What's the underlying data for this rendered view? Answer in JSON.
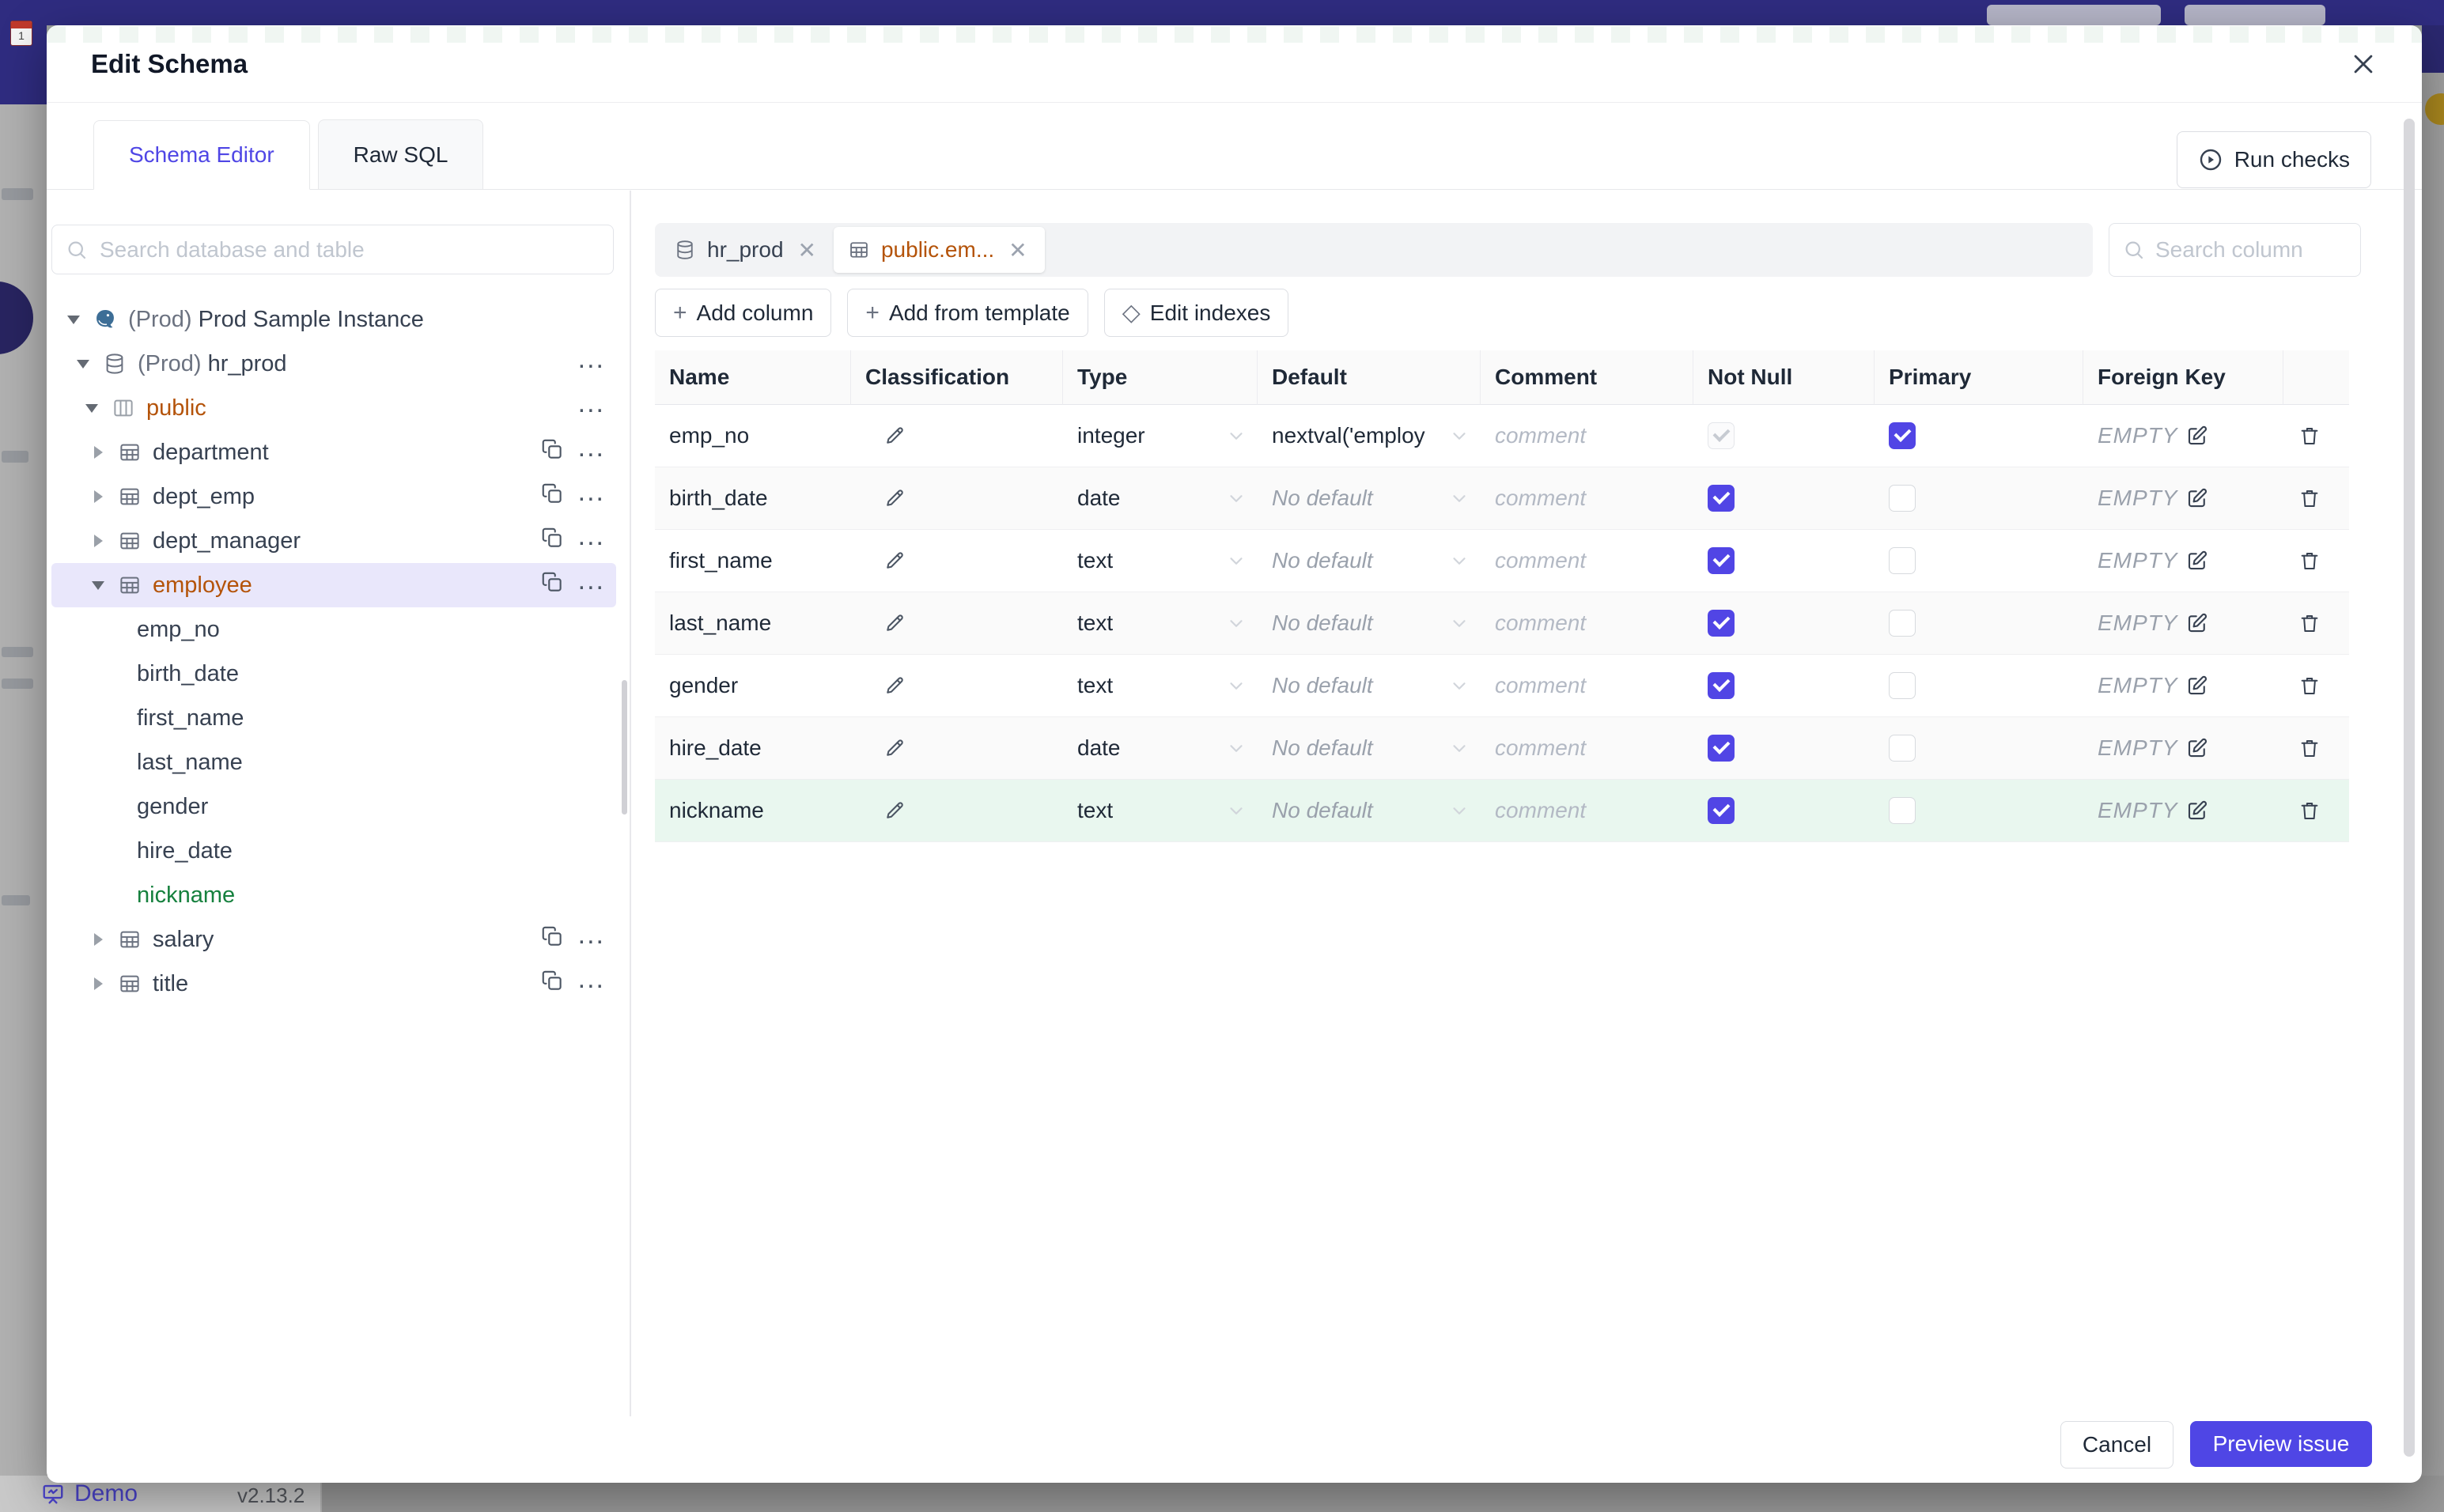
{
  "colors": {
    "accent": "#4f46e5",
    "modified_amber": "#b45309",
    "created_green": "#15803d",
    "topbar_navy": "#2f2c80",
    "checkbox_indigo": "#5145e5"
  },
  "page": {
    "brand": "Demo",
    "version": "v2.13.2"
  },
  "modal": {
    "title": "Edit Schema",
    "tabs": [
      {
        "label": "Schema Editor",
        "active": true
      },
      {
        "label": "Raw SQL",
        "active": false
      }
    ],
    "run_checks_label": "Run checks",
    "cancel_label": "Cancel",
    "preview_issue_label": "Preview issue"
  },
  "sidebar": {
    "search_placeholder": "Search database and table",
    "tree": [
      {
        "kind": "instance",
        "caret": "down",
        "prefix": "(Prod)",
        "label": "Prod Sample Instance",
        "copy": false,
        "dots": false
      },
      {
        "kind": "database",
        "caret": "down",
        "prefix": "(Prod)",
        "label": "hr_prod",
        "copy": false,
        "dots": true
      },
      {
        "kind": "schema",
        "caret": "down",
        "label": "public",
        "copy": false,
        "dots": true,
        "state": "modified"
      },
      {
        "kind": "table",
        "caret": "right",
        "label": "department",
        "copy": true,
        "dots": true
      },
      {
        "kind": "table",
        "caret": "right",
        "label": "dept_emp",
        "copy": true,
        "dots": true
      },
      {
        "kind": "table",
        "caret": "right",
        "label": "dept_manager",
        "copy": true,
        "dots": true
      },
      {
        "kind": "table",
        "caret": "down",
        "label": "employee",
        "copy": true,
        "dots": true,
        "state": "modified",
        "selected": true
      },
      {
        "kind": "column",
        "label": "emp_no"
      },
      {
        "kind": "column",
        "label": "birth_date"
      },
      {
        "kind": "column",
        "label": "first_name"
      },
      {
        "kind": "column",
        "label": "last_name"
      },
      {
        "kind": "column",
        "label": "gender"
      },
      {
        "kind": "column",
        "label": "hire_date"
      },
      {
        "kind": "column",
        "label": "nickname",
        "state": "new"
      },
      {
        "kind": "table",
        "caret": "right",
        "label": "salary",
        "copy": true,
        "dots": true
      },
      {
        "kind": "table",
        "caret": "right",
        "label": "title",
        "copy": true,
        "dots": true
      }
    ]
  },
  "editor": {
    "chips": [
      {
        "label": "hr_prod",
        "icon": "database",
        "active": false
      },
      {
        "label": "public.em...",
        "icon": "table",
        "active": true,
        "state": "modified"
      }
    ],
    "actions": [
      "Add column",
      "Add from template",
      "Edit indexes"
    ],
    "column_search_placeholder": "Search column",
    "columns_table": {
      "headers": [
        "Name",
        "Classification",
        "Type",
        "Default",
        "Comment",
        "Not Null",
        "Primary",
        "Foreign Key",
        ""
      ],
      "comment_placeholder": "comment",
      "foreign_key_value": "EMPTY",
      "rows": [
        {
          "name": "emp_no",
          "type": "integer",
          "default": "nextval('employ",
          "no_default": false,
          "not_null": true,
          "not_null_disabled": true,
          "primary": true
        },
        {
          "name": "birth_date",
          "type": "date",
          "default": "No default",
          "no_default": true,
          "not_null": true,
          "not_null_disabled": false,
          "primary": false
        },
        {
          "name": "first_name",
          "type": "text",
          "default": "No default",
          "no_default": true,
          "not_null": true,
          "not_null_disabled": false,
          "primary": false
        },
        {
          "name": "last_name",
          "type": "text",
          "default": "No default",
          "no_default": true,
          "not_null": true,
          "not_null_disabled": false,
          "primary": false
        },
        {
          "name": "gender",
          "type": "text",
          "default": "No default",
          "no_default": true,
          "not_null": true,
          "not_null_disabled": false,
          "primary": false
        },
        {
          "name": "hire_date",
          "type": "date",
          "default": "No default",
          "no_default": true,
          "not_null": true,
          "not_null_disabled": false,
          "primary": false
        },
        {
          "name": "nickname",
          "type": "text",
          "default": "No default",
          "no_default": true,
          "not_null": true,
          "not_null_disabled": false,
          "primary": false,
          "state": "new"
        }
      ]
    }
  }
}
